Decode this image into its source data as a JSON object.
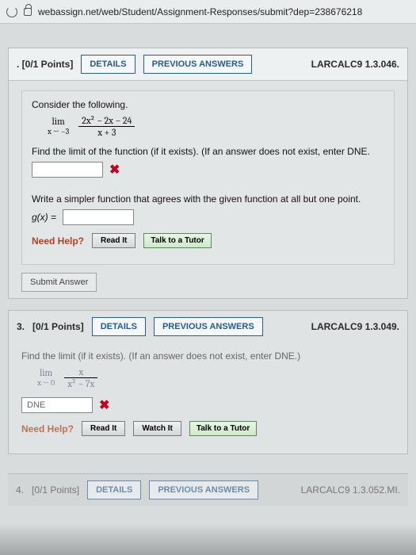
{
  "browser": {
    "url": "webassign.net/web/Student/Assignment-Responses/submit?dep=238676218"
  },
  "q2": {
    "number_prefix": ". ",
    "points": "[0/1 Points]",
    "details_btn": "DETAILS",
    "prev_btn": "PREVIOUS ANSWERS",
    "ref": "LARCALC9 1.3.046.",
    "intro": "Consider the following.",
    "lim_word": "lim",
    "lim_sub": "x → −3",
    "frac_num": "2x² − 2x − 24",
    "frac_den": "x + 3",
    "prompt1": "Find the limit of the function (if it exists). (If an answer does not exist, enter DNE.",
    "prompt2": "Write a simpler function that agrees with the given function at all but one point.",
    "g_label": "g(x) =",
    "need_help": "Need Help?",
    "read_it": "Read It",
    "talk_tutor": "Talk to a Tutor",
    "submit": "Submit Answer",
    "x_mark": "✖"
  },
  "q3": {
    "number": "3.",
    "points": "[0/1 Points]",
    "details_btn": "DETAILS",
    "prev_btn": "PREVIOUS ANSWERS",
    "ref": "LARCALC9 1.3.049.",
    "prompt": "Find the limit (if it exists). (If an answer does not exist, enter DNE.)",
    "lim_word": "lim",
    "lim_sub": "x → 0",
    "frac_num": "x",
    "frac_den": "x² − 7x",
    "answer_shown": "DNE",
    "x_mark": "✖",
    "need_help": "Need Help?",
    "read_it": "Read It",
    "watch_it": "Watch It",
    "talk_tutor": "Talk to a Tutor"
  },
  "q4": {
    "number": "4.",
    "points": "[0/1 Points]",
    "details_btn": "DETAILS",
    "prev_btn": "PREVIOUS ANSWERS",
    "ref": "LARCALC9 1.3.052.MI."
  }
}
